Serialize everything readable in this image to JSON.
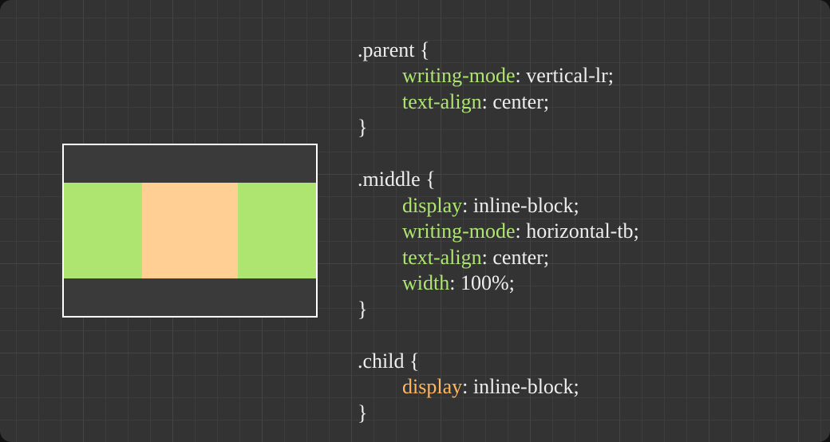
{
  "code": {
    "selectors": {
      "parent": ".parent",
      "middle": ".middle",
      "child": ".child"
    },
    "braces": {
      "open": " {",
      "close": "}"
    },
    "props": {
      "writing_mode": "writing-mode",
      "text_align": "text-align",
      "display": "display",
      "width": "width"
    },
    "vals": {
      "vertical_lr": "vertical-lr",
      "horizontal_tb": "horizontal-tb",
      "center": "center",
      "inline_block": "inline-block",
      "hundred": "100%"
    },
    "punc": {
      "colon_sp": ": ",
      "semi": ";"
    }
  },
  "colors": {
    "panel_bg": "#333333",
    "grid_strong": "#444444",
    "grid_weak": "#3d3d3d",
    "demo_border": "#ffffff",
    "demo_bg": "#3a3a3a",
    "middle": "#aee571",
    "child": "#ffcf94",
    "text": "#eeeeee",
    "accent_green": "#aee571",
    "accent_orange": "#ffb661"
  }
}
